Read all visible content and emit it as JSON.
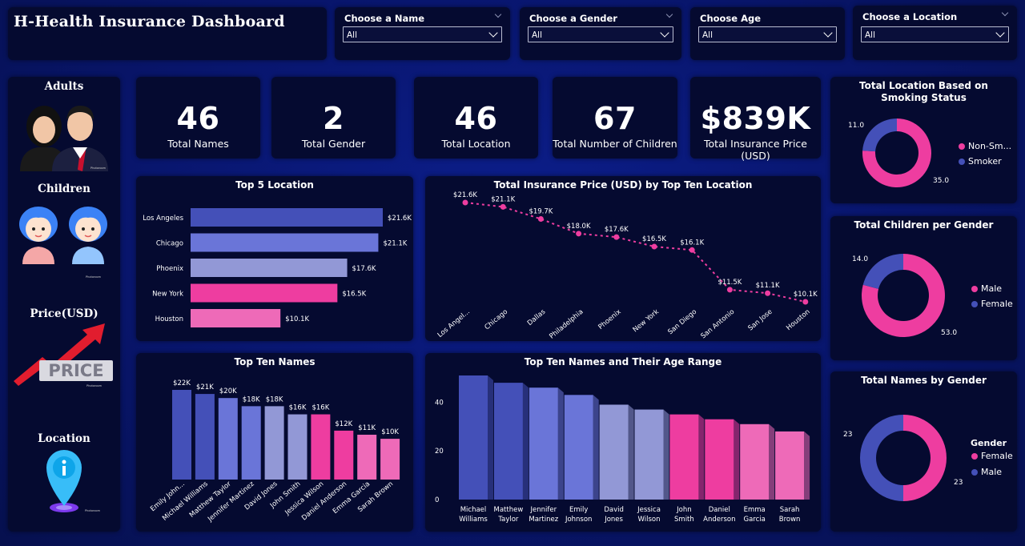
{
  "title": "H-Health Insurance Dashboard",
  "filters": [
    {
      "label": "Choose a Name",
      "value": "All"
    },
    {
      "label": "Choose a Gender",
      "value": "All"
    },
    {
      "label": "Choose Age",
      "value": "All"
    },
    {
      "label": "Choose a Location",
      "value": "All"
    }
  ],
  "sidebar": {
    "adults_label": "Adults",
    "children_label": "Children",
    "price_label": "Price(USD)",
    "price_sign": "PRICE",
    "location_label": "Location",
    "watermark": "Photoroom",
    "watermark2": "Photoroom",
    "watermark3": "Photoroom",
    "watermark4": "Photoroom"
  },
  "kpis": [
    {
      "value": "46",
      "label": "Total Names"
    },
    {
      "value": "2",
      "label": "Total Gender"
    },
    {
      "value": "46",
      "label": "Total Location"
    },
    {
      "value": "67",
      "label": "Total Number of Children"
    },
    {
      "value": "$839K",
      "label": "Total Insurance Price (USD)"
    }
  ],
  "colors": {
    "blue_dark": "#4450b8",
    "blue_mid": "#6a75d8",
    "blue_light": "#9298d6",
    "pink": "#ee3da0",
    "pink_light": "#ee6ab8",
    "card_bg": "#050a30"
  },
  "chart_data": [
    {
      "id": "top5",
      "type": "bar",
      "orientation": "horizontal",
      "title": "Top 5 Location",
      "categories": [
        "Los Angeles",
        "Chicago",
        "Phoenix",
        "New York",
        "Houston"
      ],
      "values": [
        21.6,
        21.1,
        17.6,
        16.5,
        10.1
      ],
      "labels": [
        "$21.6K",
        "$21.1K",
        "$17.6K",
        "$16.5K",
        "$10.1K"
      ],
      "colors": [
        "#4450b8",
        "#6a75d8",
        "#9298d6",
        "#ee3da0",
        "#ee6ab8"
      ]
    },
    {
      "id": "line",
      "type": "line",
      "title": "Total Insurance Price (USD) by Top Ten Location",
      "categories": [
        "Los Angel...",
        "Chicago",
        "Dallas",
        "Philadelphia",
        "Phoenix",
        "New York",
        "San Diego",
        "San Antonio",
        "San Jose",
        "Houston"
      ],
      "values": [
        21.6,
        21.1,
        19.7,
        18.0,
        17.6,
        16.5,
        16.1,
        11.5,
        11.1,
        10.1
      ],
      "labels": [
        "$21.6K",
        "$21.1K",
        "$19.7K",
        "$18.0K",
        "$17.6K",
        "$16.5K",
        "$16.1K",
        "$11.5K",
        "$11.1K",
        "$10.1K"
      ]
    },
    {
      "id": "smoking",
      "type": "pie",
      "title": "Total Location Based on Smoking Status",
      "slices": [
        {
          "name": "Non-Sm...",
          "value": 35.0,
          "label": "35.0",
          "color": "#ee3da0"
        },
        {
          "name": "Smoker",
          "value": 11.0,
          "label": "11.0",
          "color": "#4450b8"
        }
      ]
    },
    {
      "id": "children_gender",
      "type": "pie",
      "title": "Total Children per Gender",
      "slices": [
        {
          "name": "Male",
          "value": 53.0,
          "label": "53.0",
          "color": "#ee3da0"
        },
        {
          "name": "Female",
          "value": 14.0,
          "label": "14.0",
          "color": "#4450b8"
        }
      ]
    },
    {
      "id": "top10names",
      "type": "bar",
      "title": "Top Ten Names",
      "categories": [
        "Emily John...",
        "Michael Williams",
        "Matthew Taylor",
        "Jennifer Martinez",
        "David Jones",
        "John Smith",
        "Jessica Wilson",
        "Daniel Anderson",
        "Emma Garcia",
        "Sarah Brown"
      ],
      "values": [
        22,
        21,
        20,
        18,
        18,
        16,
        16,
        12,
        11,
        10
      ],
      "labels": [
        "$22K",
        "$21K",
        "$20K",
        "$18K",
        "$18K",
        "$16K",
        "$16K",
        "$12K",
        "$11K",
        "$10K"
      ],
      "colors": [
        "#4450b8",
        "#4450b8",
        "#6a75d8",
        "#6a75d8",
        "#9298d6",
        "#9298d6",
        "#ee3da0",
        "#ee3da0",
        "#ee6ab8",
        "#ee6ab8"
      ]
    },
    {
      "id": "agerange",
      "type": "bar",
      "title": "Top Ten Names and Their Age Range",
      "categories": [
        "Michael\nWilliams",
        "Matthew\nTaylor",
        "Jennifer\nMartinez",
        "Emily\nJohnson",
        "David\nJones",
        "Jessica\nWilson",
        "John\nSmith",
        "Daniel\nAnderson",
        "Emma\nGarcia",
        "Sarah\nBrown"
      ],
      "values": [
        51,
        48,
        46,
        43,
        39,
        37,
        35,
        33,
        31,
        28
      ],
      "yticks": [
        "0",
        "20",
        "40"
      ],
      "ylim": [
        0,
        51
      ],
      "colors": [
        "#4450b8",
        "#4450b8",
        "#6a75d8",
        "#6a75d8",
        "#9298d6",
        "#9298d6",
        "#ee3da0",
        "#ee3da0",
        "#ee6ab8",
        "#ee6ab8"
      ]
    },
    {
      "id": "names_gender",
      "type": "pie",
      "title": "Total Names by Gender",
      "legend_title": "Gender",
      "slices": [
        {
          "name": "Female",
          "value": 23,
          "label": "23",
          "color": "#ee3da0"
        },
        {
          "name": "Male",
          "value": 23,
          "label": "23",
          "color": "#4450b8"
        }
      ]
    }
  ]
}
